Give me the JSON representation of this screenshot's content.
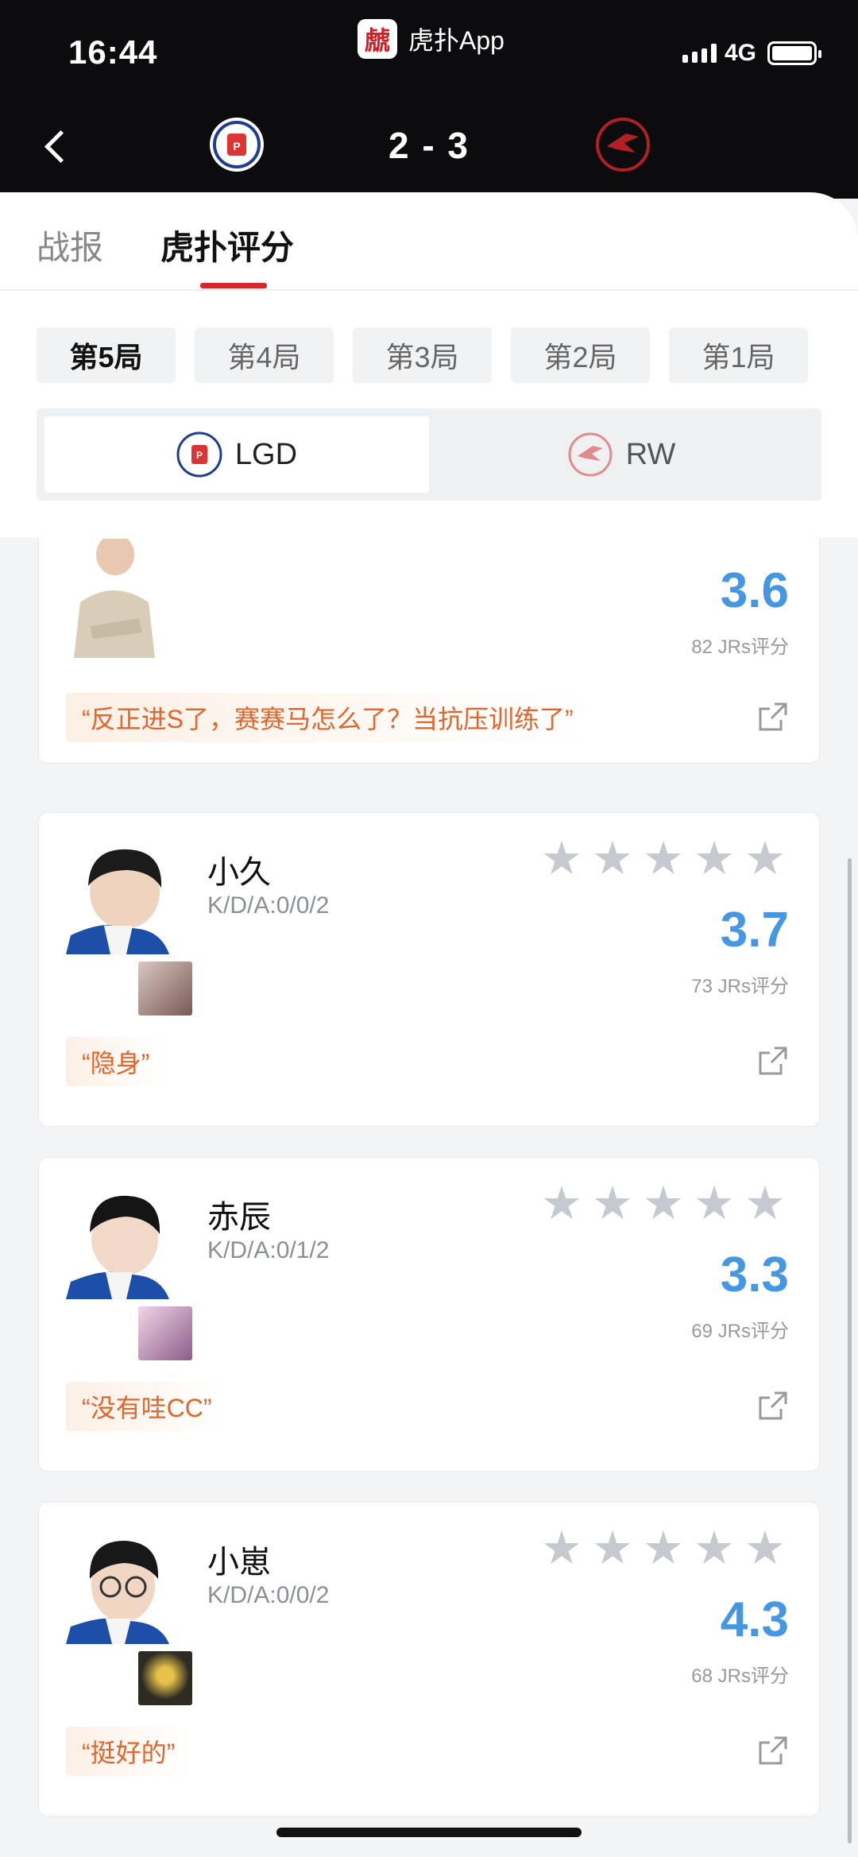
{
  "status_bar": {
    "time": "16:44",
    "app_name": "虎扑App",
    "app_logo_char": "虤",
    "network": "4G"
  },
  "header": {
    "score": "2 - 3",
    "home_team": "LGD",
    "away_team": "RW"
  },
  "tabs": [
    {
      "label": "战报"
    },
    {
      "label": "虎扑评分"
    }
  ],
  "games": [
    {
      "label": "第5局",
      "active": true
    },
    {
      "label": "第4局",
      "active": false
    },
    {
      "label": "第3局",
      "active": false
    },
    {
      "label": "第2局",
      "active": false
    },
    {
      "label": "第1局",
      "active": false
    }
  ],
  "team_switch": {
    "lgd": "LGD",
    "rw": "RW",
    "selected": "LGD"
  },
  "players": [
    {
      "name": "",
      "kda": "",
      "rating": "3.6",
      "votes": "82 JRs评分",
      "comment": "“反正进S了，赛赛马怎么了？当抗压训练了”"
    },
    {
      "name": "小久",
      "kda": "K/D/A:0/0/2",
      "rating": "3.7",
      "votes": "73 JRs评分",
      "comment": "“隐身”"
    },
    {
      "name": "赤辰",
      "kda": "K/D/A:0/1/2",
      "rating": "3.3",
      "votes": "69 JRs评分",
      "comment": "“没有哇CC”"
    },
    {
      "name": "小崽",
      "kda": "K/D/A:0/0/2",
      "rating": "4.3",
      "votes": "68 JRs评分",
      "comment": "“挺好的”"
    }
  ],
  "colors": {
    "accent_red": "#d8262d",
    "rating_blue": "#4497e0",
    "comment_orange": "#e2652b",
    "star_gray": "#c7c9d1"
  }
}
